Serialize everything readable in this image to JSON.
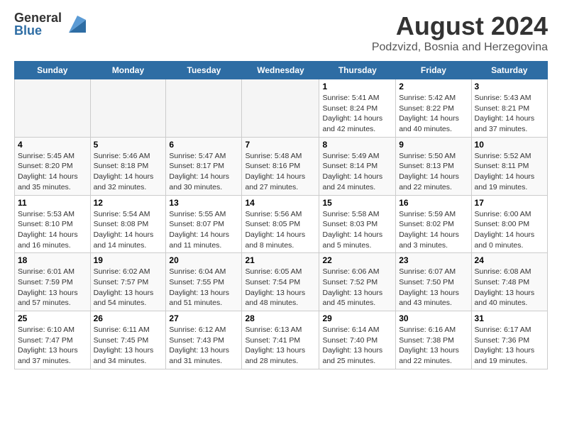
{
  "logo": {
    "general": "General",
    "blue": "Blue"
  },
  "title": "August 2024",
  "subtitle": "Podzvizd, Bosnia and Herzegovina",
  "days_of_week": [
    "Sunday",
    "Monday",
    "Tuesday",
    "Wednesday",
    "Thursday",
    "Friday",
    "Saturday"
  ],
  "weeks": [
    [
      {
        "day": "",
        "info": ""
      },
      {
        "day": "",
        "info": ""
      },
      {
        "day": "",
        "info": ""
      },
      {
        "day": "",
        "info": ""
      },
      {
        "day": "1",
        "info": "Sunrise: 5:41 AM\nSunset: 8:24 PM\nDaylight: 14 hours\nand 42 minutes."
      },
      {
        "day": "2",
        "info": "Sunrise: 5:42 AM\nSunset: 8:22 PM\nDaylight: 14 hours\nand 40 minutes."
      },
      {
        "day": "3",
        "info": "Sunrise: 5:43 AM\nSunset: 8:21 PM\nDaylight: 14 hours\nand 37 minutes."
      }
    ],
    [
      {
        "day": "4",
        "info": "Sunrise: 5:45 AM\nSunset: 8:20 PM\nDaylight: 14 hours\nand 35 minutes."
      },
      {
        "day": "5",
        "info": "Sunrise: 5:46 AM\nSunset: 8:18 PM\nDaylight: 14 hours\nand 32 minutes."
      },
      {
        "day": "6",
        "info": "Sunrise: 5:47 AM\nSunset: 8:17 PM\nDaylight: 14 hours\nand 30 minutes."
      },
      {
        "day": "7",
        "info": "Sunrise: 5:48 AM\nSunset: 8:16 PM\nDaylight: 14 hours\nand 27 minutes."
      },
      {
        "day": "8",
        "info": "Sunrise: 5:49 AM\nSunset: 8:14 PM\nDaylight: 14 hours\nand 24 minutes."
      },
      {
        "day": "9",
        "info": "Sunrise: 5:50 AM\nSunset: 8:13 PM\nDaylight: 14 hours\nand 22 minutes."
      },
      {
        "day": "10",
        "info": "Sunrise: 5:52 AM\nSunset: 8:11 PM\nDaylight: 14 hours\nand 19 minutes."
      }
    ],
    [
      {
        "day": "11",
        "info": "Sunrise: 5:53 AM\nSunset: 8:10 PM\nDaylight: 14 hours\nand 16 minutes."
      },
      {
        "day": "12",
        "info": "Sunrise: 5:54 AM\nSunset: 8:08 PM\nDaylight: 14 hours\nand 14 minutes."
      },
      {
        "day": "13",
        "info": "Sunrise: 5:55 AM\nSunset: 8:07 PM\nDaylight: 14 hours\nand 11 minutes."
      },
      {
        "day": "14",
        "info": "Sunrise: 5:56 AM\nSunset: 8:05 PM\nDaylight: 14 hours\nand 8 minutes."
      },
      {
        "day": "15",
        "info": "Sunrise: 5:58 AM\nSunset: 8:03 PM\nDaylight: 14 hours\nand 5 minutes."
      },
      {
        "day": "16",
        "info": "Sunrise: 5:59 AM\nSunset: 8:02 PM\nDaylight: 14 hours\nand 3 minutes."
      },
      {
        "day": "17",
        "info": "Sunrise: 6:00 AM\nSunset: 8:00 PM\nDaylight: 14 hours\nand 0 minutes."
      }
    ],
    [
      {
        "day": "18",
        "info": "Sunrise: 6:01 AM\nSunset: 7:59 PM\nDaylight: 13 hours\nand 57 minutes."
      },
      {
        "day": "19",
        "info": "Sunrise: 6:02 AM\nSunset: 7:57 PM\nDaylight: 13 hours\nand 54 minutes."
      },
      {
        "day": "20",
        "info": "Sunrise: 6:04 AM\nSunset: 7:55 PM\nDaylight: 13 hours\nand 51 minutes."
      },
      {
        "day": "21",
        "info": "Sunrise: 6:05 AM\nSunset: 7:54 PM\nDaylight: 13 hours\nand 48 minutes."
      },
      {
        "day": "22",
        "info": "Sunrise: 6:06 AM\nSunset: 7:52 PM\nDaylight: 13 hours\nand 45 minutes."
      },
      {
        "day": "23",
        "info": "Sunrise: 6:07 AM\nSunset: 7:50 PM\nDaylight: 13 hours\nand 43 minutes."
      },
      {
        "day": "24",
        "info": "Sunrise: 6:08 AM\nSunset: 7:48 PM\nDaylight: 13 hours\nand 40 minutes."
      }
    ],
    [
      {
        "day": "25",
        "info": "Sunrise: 6:10 AM\nSunset: 7:47 PM\nDaylight: 13 hours\nand 37 minutes."
      },
      {
        "day": "26",
        "info": "Sunrise: 6:11 AM\nSunset: 7:45 PM\nDaylight: 13 hours\nand 34 minutes."
      },
      {
        "day": "27",
        "info": "Sunrise: 6:12 AM\nSunset: 7:43 PM\nDaylight: 13 hours\nand 31 minutes."
      },
      {
        "day": "28",
        "info": "Sunrise: 6:13 AM\nSunset: 7:41 PM\nDaylight: 13 hours\nand 28 minutes."
      },
      {
        "day": "29",
        "info": "Sunrise: 6:14 AM\nSunset: 7:40 PM\nDaylight: 13 hours\nand 25 minutes."
      },
      {
        "day": "30",
        "info": "Sunrise: 6:16 AM\nSunset: 7:38 PM\nDaylight: 13 hours\nand 22 minutes."
      },
      {
        "day": "31",
        "info": "Sunrise: 6:17 AM\nSunset: 7:36 PM\nDaylight: 13 hours\nand 19 minutes."
      }
    ]
  ]
}
